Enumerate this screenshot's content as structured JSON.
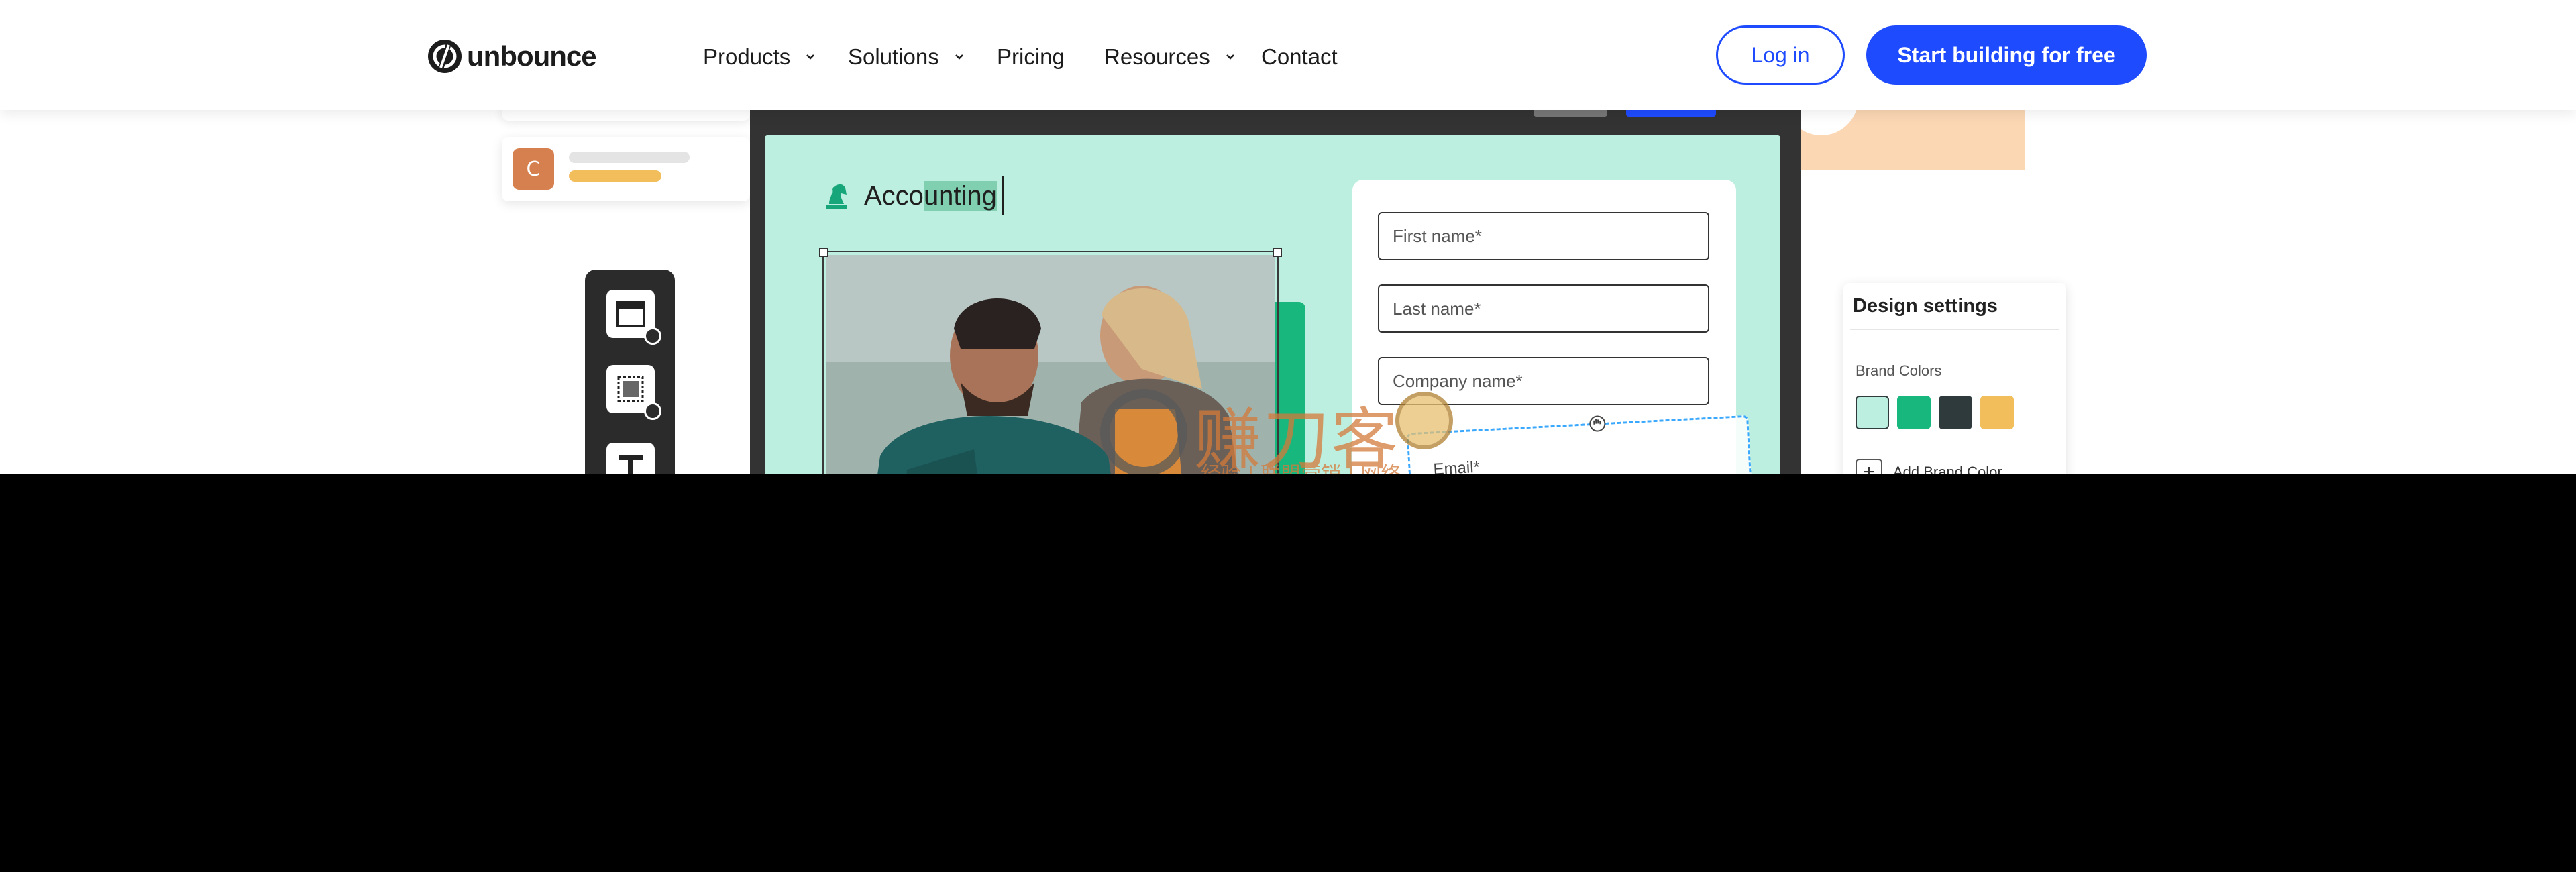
{
  "nav": {
    "logo_text": "unbounce",
    "items": [
      {
        "label": "Products",
        "has_dropdown": true
      },
      {
        "label": "Solutions",
        "has_dropdown": true
      },
      {
        "label": "Pricing",
        "has_dropdown": false
      },
      {
        "label": "Resources",
        "has_dropdown": true
      },
      {
        "label": "Contact",
        "has_dropdown": false
      }
    ],
    "login_label": "Log in",
    "cta_label": "Start building for free"
  },
  "hero": {
    "side_card": {
      "avatar_letter": "C"
    },
    "editor": {
      "brand_text_plain": "Acco",
      "brand_text_selected": "unting",
      "form": {
        "fields": [
          {
            "placeholder": "First name*"
          },
          {
            "placeholder": "Last name*"
          },
          {
            "placeholder": "Company name*"
          }
        ],
        "dragged_field_label": "Email*"
      }
    },
    "design_settings": {
      "title": "Design settings",
      "brand_colors_label": "Brand Colors",
      "swatches": [
        "#bcefdf",
        "#17b77e",
        "#2f3a3c",
        "#f2bd5b"
      ],
      "add_label": "Add Brand Color"
    }
  },
  "watermark": {
    "chars": "赚刀客",
    "small": "经验 | 联盟营销 | 网络"
  },
  "colors": {
    "accent": "#1f4bff",
    "canvas": "#bcefdf",
    "green": "#17b77e"
  }
}
